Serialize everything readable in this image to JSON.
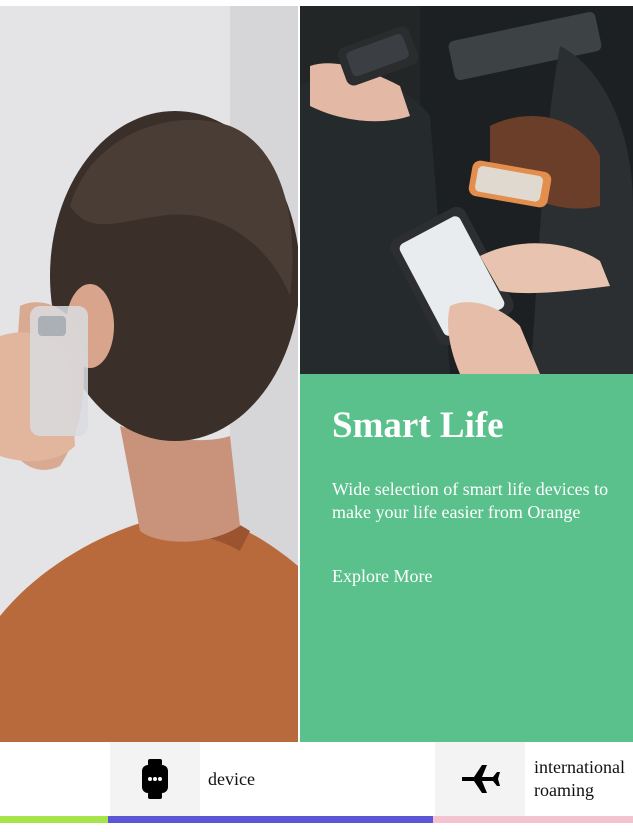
{
  "promo": {
    "title": "Smart Life",
    "description": "Wide selection of smart life devices to make your life easier from Orange",
    "link_label": "Explore More"
  },
  "categories": [
    {
      "label": "device",
      "icon": "smartwatch-icon"
    },
    {
      "label": "international roaming",
      "icon": "airplane-icon"
    }
  ],
  "colors": {
    "promo_background": "#5ac18c",
    "underline_segments": [
      "#a6e44a",
      "#5c55d6",
      "#f5c3cf"
    ]
  },
  "images": [
    {
      "description_icon": "person-on-phone-photo"
    },
    {
      "description_icon": "people-with-phones-photo"
    }
  ]
}
